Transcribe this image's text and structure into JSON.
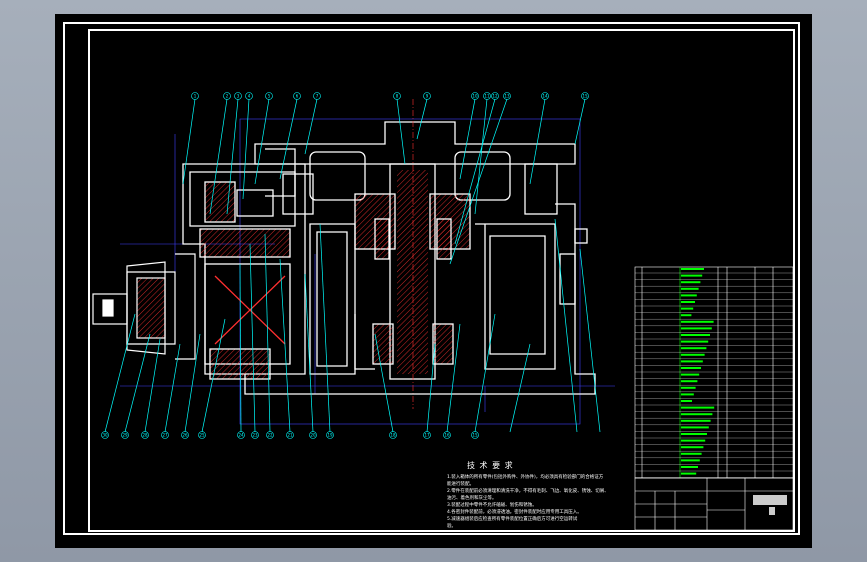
{
  "notes": {
    "title": "技 术 要 求",
    "lines": [
      "1.装入箱体的所有零件(包括外购件、外协件)，均必须具有检验部门的合格证方",
      "能进行装配。",
      "2.零件在装配前必须清理和清洗干净，不得有毛刺、飞边、氧化皮、锈蚀、切屑、",
      "油污、着色剂和灰尘等。",
      "3.装配过程中零件不允许磕碰、划伤和锈蚀。",
      "4.各密封件装配前，必须浸透油。密封件装配时应用专用工具压入。",
      "5.减速器组装后应检查所有零件装配位置正确后方可进行空运转试",
      "验。"
    ]
  },
  "balloons": {
    "top": [
      "1",
      "2",
      "3",
      "4",
      "5",
      "6",
      "7",
      "8",
      "9",
      "10",
      "11",
      "12",
      "13",
      "14",
      "15"
    ],
    "bottom": [
      "30",
      "29",
      "28",
      "27",
      "26",
      "25",
      "24",
      "23",
      "22",
      "21",
      "20",
      "19",
      "18",
      "17",
      "16",
      "15"
    ]
  },
  "colors": {
    "background": "#000000",
    "frame": "#ffffff",
    "part_outline": "#ffffff",
    "hatch": "#ff3030",
    "leader": "#00ffff",
    "dimension": "#4040ff",
    "centerline": "#ff3030",
    "table_text": "#00ff00",
    "window_chrome": "#9aa3b0"
  }
}
